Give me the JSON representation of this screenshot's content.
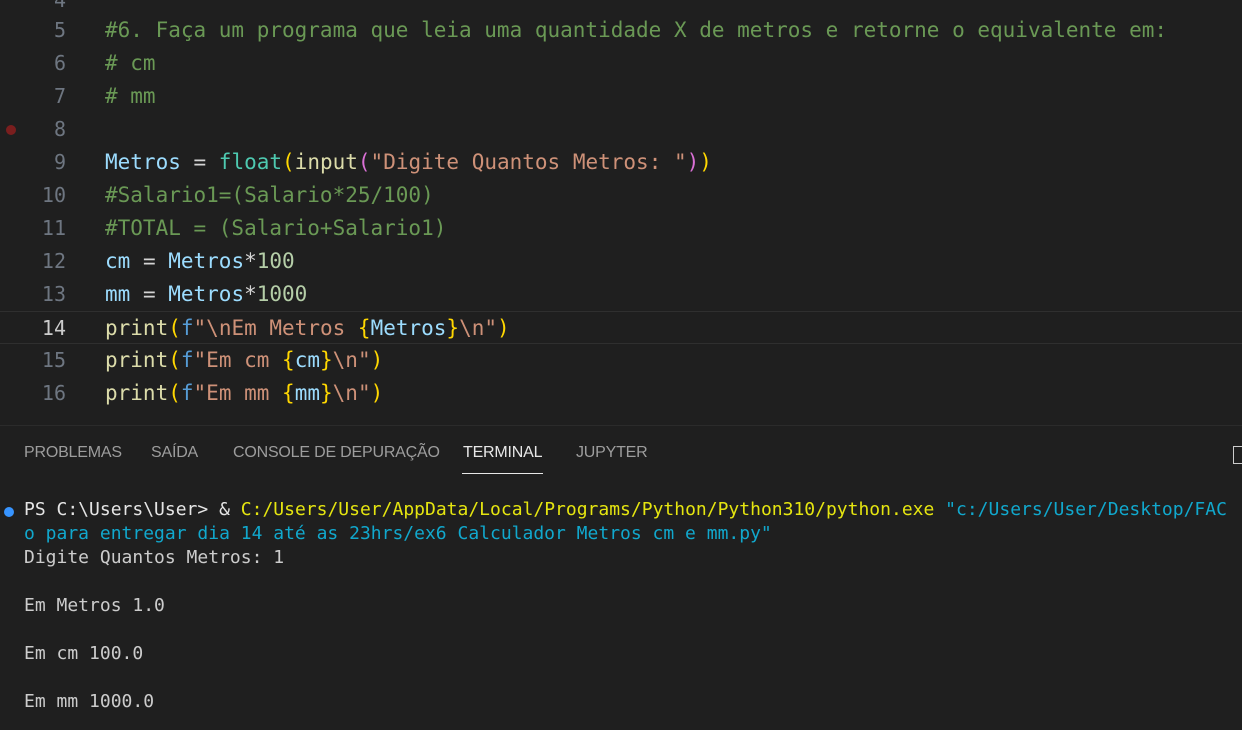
{
  "editor": {
    "top_partial_number": "4",
    "lines": [
      {
        "num": "5",
        "parts": [
          {
            "t": "#6. Faça um programa que leia uma quantidade X de metros e retorne o equivalente em:",
            "c": "comment"
          }
        ]
      },
      {
        "num": "6",
        "parts": [
          {
            "t": "# cm",
            "c": "comment"
          }
        ]
      },
      {
        "num": "7",
        "parts": [
          {
            "t": "# mm",
            "c": "comment"
          }
        ]
      },
      {
        "num": "8",
        "parts": [],
        "breakpoint": true
      },
      {
        "num": "9",
        "parts": [
          {
            "t": "Metros",
            "c": "var"
          },
          {
            "t": " = ",
            "c": "text"
          },
          {
            "t": "float",
            "c": "builtin"
          },
          {
            "t": "(",
            "c": "b1"
          },
          {
            "t": "input",
            "c": "fn"
          },
          {
            "t": "(",
            "c": "b2"
          },
          {
            "t": "\"Digite Quantos Metros: \"",
            "c": "str"
          },
          {
            "t": ")",
            "c": "b2"
          },
          {
            "t": ")",
            "c": "b1"
          }
        ]
      },
      {
        "num": "10",
        "parts": [
          {
            "t": "#Salario1=(Salario*25/100)",
            "c": "comment"
          }
        ]
      },
      {
        "num": "11",
        "parts": [
          {
            "t": "#TOTAL = (Salario+Salario1)",
            "c": "comment"
          }
        ]
      },
      {
        "num": "12",
        "parts": [
          {
            "t": "cm",
            "c": "var"
          },
          {
            "t": " = ",
            "c": "text"
          },
          {
            "t": "Metros",
            "c": "var"
          },
          {
            "t": "*",
            "c": "text"
          },
          {
            "t": "100",
            "c": "num"
          }
        ]
      },
      {
        "num": "13",
        "parts": [
          {
            "t": "mm",
            "c": "var"
          },
          {
            "t": " = ",
            "c": "text"
          },
          {
            "t": "Metros",
            "c": "var"
          },
          {
            "t": "*",
            "c": "text"
          },
          {
            "t": "1000",
            "c": "num"
          }
        ]
      },
      {
        "num": "14",
        "current": true,
        "parts": [
          {
            "t": "print",
            "c": "fn"
          },
          {
            "t": "(",
            "c": "b1"
          },
          {
            "t": "f",
            "c": "kw"
          },
          {
            "t": "\"\\nEm Metros ",
            "c": "str"
          },
          {
            "t": "{",
            "c": "b1"
          },
          {
            "t": "Metros",
            "c": "var"
          },
          {
            "t": "}",
            "c": "b1"
          },
          {
            "t": "\\n\"",
            "c": "str"
          },
          {
            "t": ")",
            "c": "b1"
          }
        ]
      },
      {
        "num": "15",
        "parts": [
          {
            "t": "print",
            "c": "fn"
          },
          {
            "t": "(",
            "c": "b1"
          },
          {
            "t": "f",
            "c": "kw"
          },
          {
            "t": "\"Em cm ",
            "c": "str"
          },
          {
            "t": "{",
            "c": "b1"
          },
          {
            "t": "cm",
            "c": "var"
          },
          {
            "t": "}",
            "c": "b1"
          },
          {
            "t": "\\n\"",
            "c": "str"
          },
          {
            "t": ")",
            "c": "b1"
          }
        ]
      },
      {
        "num": "16",
        "parts": [
          {
            "t": "print",
            "c": "fn"
          },
          {
            "t": "(",
            "c": "b1"
          },
          {
            "t": "f",
            "c": "kw"
          },
          {
            "t": "\"Em mm ",
            "c": "str"
          },
          {
            "t": "{",
            "c": "b1"
          },
          {
            "t": "mm",
            "c": "var"
          },
          {
            "t": "}",
            "c": "b1"
          },
          {
            "t": "\\n\"",
            "c": "str"
          },
          {
            "t": ")",
            "c": "b1"
          }
        ]
      }
    ]
  },
  "panel": {
    "tabs": {
      "problems": "PROBLEMAS",
      "output": "SAÍDA",
      "debug_console": "CONSOLE DE DEPURAÇÃO",
      "terminal": "TERMINAL",
      "jupyter": "JUPYTER"
    },
    "active_tab": "TERMINAL"
  },
  "terminal": {
    "prompt": "PS C:\\Users\\User> ",
    "amp": "& ",
    "exe_path": "C:/Users/User/AppData/Local/Programs/Python/Python310/python.exe",
    "script_path_1": "\"c:/Users/User/Desktop/FAC",
    "script_path_2": "o para entregar dia 14 até as 23hrs/ex6 Calculador Metros cm e mm.py\"",
    "input_line": "Digite Quantos Metros: 1",
    "out_metros": "Em Metros 1.0",
    "out_cm": "Em cm 100.0",
    "out_mm": "Em mm 1000.0"
  },
  "colors": {
    "comment": "#6a9955",
    "string": "#ce9178",
    "function": "#dcdcaa",
    "builtin": "#4ec9b0",
    "number": "#b5cea8",
    "keyword": "#569cd6",
    "terminal_yellow": "#e5e510",
    "terminal_cyan": "#11a8cd"
  }
}
